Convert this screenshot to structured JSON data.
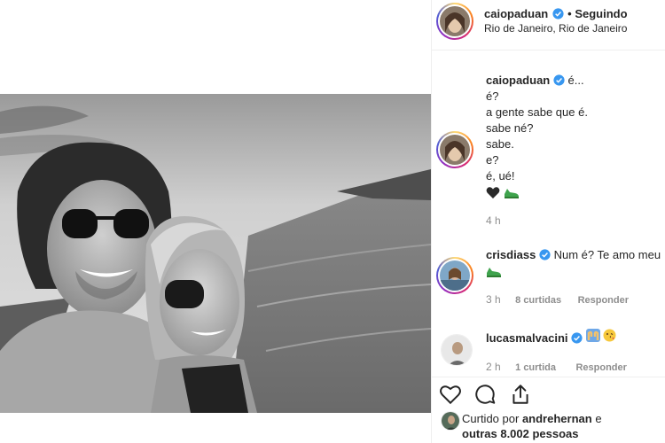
{
  "post": {
    "author": "caiopaduan",
    "follow_state": "Seguindo",
    "location": "Rio de Janeiro, Rio de Janeiro"
  },
  "caption": {
    "username": "caiopaduan",
    "lines": [
      "é...",
      "é?",
      "a gente sabe que é.",
      "sabe né?",
      "sabe.",
      "e?",
      "é, ué!"
    ],
    "time": "4 h"
  },
  "comments": [
    {
      "username": "crisdiass",
      "text": "Num é? Te amo meu",
      "time": "3 h",
      "likes": "8 curtidas",
      "reply": "Responder"
    },
    {
      "username": "lucasmalvacini",
      "text": "",
      "time": "2 h",
      "likes": "1 curtida",
      "reply": "Responder"
    }
  ],
  "likes": {
    "prefix": "Curtido por",
    "user": "andrehernan",
    "joiner": "e",
    "others": "outras 8.002 pessoas"
  },
  "colors": {
    "verified": "#3897f0",
    "muted": "#8e8e8e",
    "text": "#262626"
  },
  "icons": [
    "heart-icon",
    "comment-icon",
    "share-icon",
    "verified-icon",
    "black-heart-icon",
    "shoe-icon",
    "hands-icon",
    "kiss-emoji-icon"
  ]
}
